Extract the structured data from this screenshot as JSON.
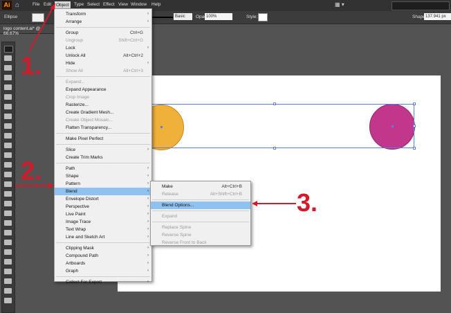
{
  "app": {
    "logo": "Ai",
    "home_icon": "home-icon"
  },
  "menubar": {
    "items": [
      "File",
      "Edit",
      "Object",
      "Type",
      "Select",
      "Effect",
      "View",
      "Window",
      "Help"
    ],
    "active": "Object"
  },
  "control_bar": {
    "selection_type": "Ellipse",
    "stroke_value": "?",
    "brush": "Basic",
    "opacity_label": "Opacity:",
    "opacity_value": "100%",
    "style_label": "Style:",
    "shape_label": "Shape:",
    "shape_value": "137.941 px"
  },
  "document_tab": {
    "title": "logo content.ai* @ 66.67%"
  },
  "object_menu": [
    {
      "label": "Transform",
      "submenu": true
    },
    {
      "label": "Arrange",
      "submenu": true
    },
    {
      "sep": true
    },
    {
      "label": "Group",
      "shortcut": "Ctrl+G"
    },
    {
      "label": "Ungroup",
      "shortcut": "Shift+Ctrl+G",
      "disabled": true
    },
    {
      "label": "Lock",
      "submenu": true
    },
    {
      "label": "Unlock All",
      "shortcut": "Alt+Ctrl+2"
    },
    {
      "label": "Hide",
      "submenu": true
    },
    {
      "label": "Show All",
      "shortcut": "Alt+Ctrl+3",
      "disabled": true
    },
    {
      "sep": true
    },
    {
      "label": "Expand...",
      "disabled": true
    },
    {
      "label": "Expand Appearance"
    },
    {
      "label": "Crop Image",
      "disabled": true
    },
    {
      "label": "Rasterize..."
    },
    {
      "label": "Create Gradient Mesh..."
    },
    {
      "label": "Create Object Mosaic...",
      "disabled": true
    },
    {
      "label": "Flatten Transparency..."
    },
    {
      "sep": true
    },
    {
      "label": "Make Pixel Perfect"
    },
    {
      "sep": true
    },
    {
      "label": "Slice",
      "submenu": true
    },
    {
      "label": "Create Trim Marks"
    },
    {
      "sep": true
    },
    {
      "label": "Path",
      "submenu": true
    },
    {
      "label": "Shape",
      "submenu": true
    },
    {
      "label": "Pattern",
      "submenu": true
    },
    {
      "label": "Blend",
      "submenu": true,
      "highlighted": true
    },
    {
      "label": "Envelope Distort",
      "submenu": true
    },
    {
      "label": "Perspective",
      "submenu": true
    },
    {
      "label": "Live Paint",
      "submenu": true
    },
    {
      "label": "Image Trace",
      "submenu": true
    },
    {
      "label": "Text Wrap",
      "submenu": true
    },
    {
      "label": "Line and Sketch Art",
      "submenu": true
    },
    {
      "sep": true
    },
    {
      "label": "Clipping Mask",
      "submenu": true
    },
    {
      "label": "Compound Path",
      "submenu": true
    },
    {
      "label": "Artboards",
      "submenu": true
    },
    {
      "label": "Graph",
      "submenu": true
    },
    {
      "sep": true
    },
    {
      "label": "Collect For Export",
      "submenu": true
    }
  ],
  "blend_submenu": [
    {
      "label": "Make",
      "shortcut": "Alt+Ctrl+B"
    },
    {
      "label": "Release",
      "shortcut": "Alt+Shift+Ctrl+B",
      "disabled": true
    },
    {
      "sep": true
    },
    {
      "label": "Blend Options...",
      "highlighted": true
    },
    {
      "sep": true
    },
    {
      "label": "Expand",
      "disabled": true
    },
    {
      "sep": true
    },
    {
      "label": "Replace Spine",
      "disabled": true
    },
    {
      "label": "Reverse Spine",
      "disabled": true
    },
    {
      "label": "Reverse Front to Back",
      "disabled": true
    }
  ],
  "annotations": {
    "step1": "1.",
    "step2": "2.",
    "step3": "3."
  },
  "colors": {
    "accent_red": "#d11a2a",
    "orange_circle": "#f0b13a",
    "pink_circle": "#c2378c",
    "selection_blue": "#5b7ee0",
    "menu_highlight": "#8fc2f0"
  }
}
